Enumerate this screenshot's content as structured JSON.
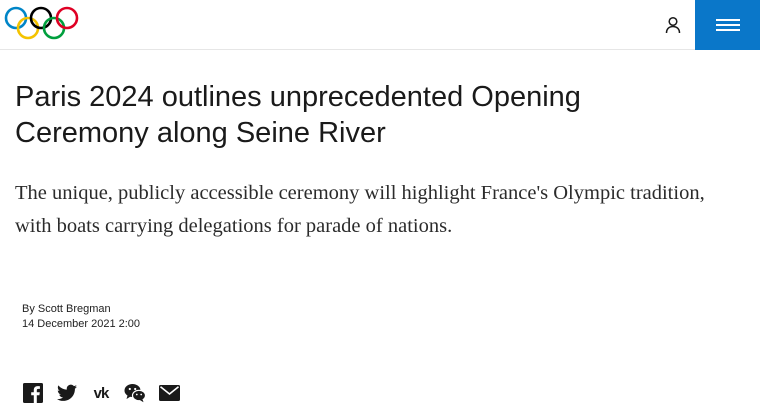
{
  "header": {
    "logo_icon": "olympic-rings-icon",
    "user_icon": "user-icon",
    "menu_icon": "hamburger-menu-icon",
    "menu_bg_color": "#0a77c9",
    "ring_colors": [
      "#0085c7",
      "#f4c300",
      "#000000",
      "#009f3d",
      "#df0024"
    ]
  },
  "article": {
    "title": "Paris 2024 outlines unprecedented Opening Ceremony along Seine River",
    "summary": "The unique, publicly accessible ceremony will highlight France's Olympic tradition, with boats carrying delegations for parade of nations.",
    "author": "By Scott Bregman",
    "date": "14 December 2021 2:00"
  },
  "share": {
    "facebook_icon": "facebook-icon",
    "twitter_icon": "twitter-icon",
    "vk_icon": "vk-icon",
    "vk_glyph": "vk",
    "wechat_icon": "wechat-icon",
    "email_icon": "email-icon"
  }
}
